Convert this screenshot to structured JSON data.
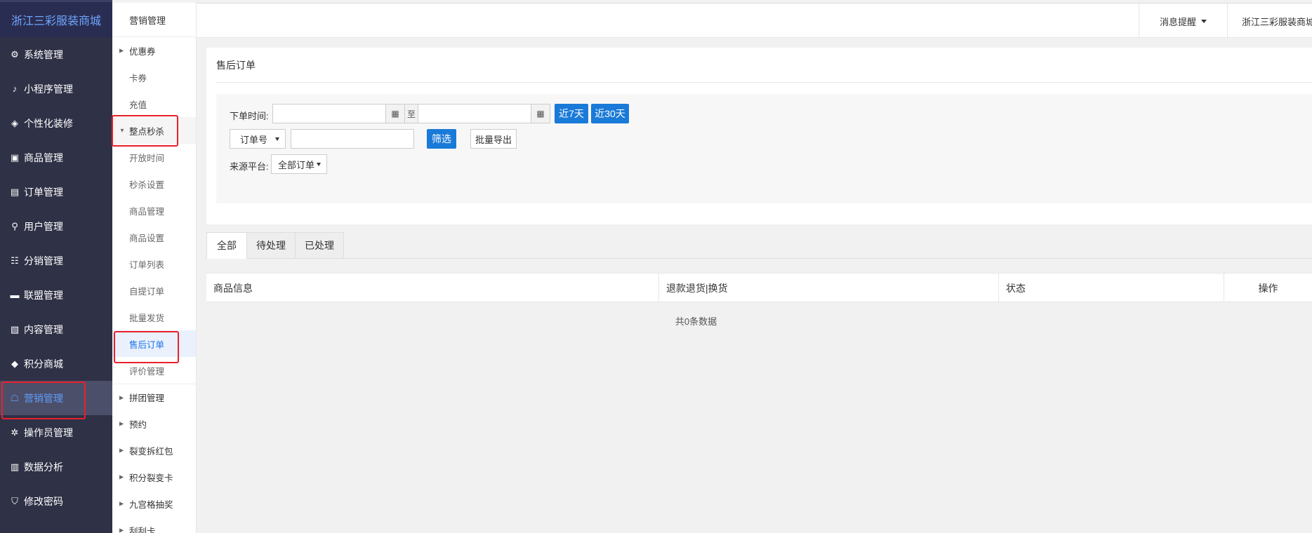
{
  "brand": "浙江三彩服装商城",
  "sidebar": {
    "items": [
      {
        "label": "系统管理",
        "icon": "gear-icon"
      },
      {
        "label": "小程序管理",
        "icon": "miniapp-icon"
      },
      {
        "label": "个性化装修",
        "icon": "palette-icon"
      },
      {
        "label": "商品管理",
        "icon": "bag-icon"
      },
      {
        "label": "订单管理",
        "icon": "clipboard-icon"
      },
      {
        "label": "用户管理",
        "icon": "user-icon"
      },
      {
        "label": "分销管理",
        "icon": "sitemap-icon"
      },
      {
        "label": "联盟管理",
        "icon": "store-icon"
      },
      {
        "label": "内容管理",
        "icon": "content-icon"
      },
      {
        "label": "积分商城",
        "icon": "cube-icon"
      },
      {
        "label": "营销管理",
        "icon": "marketing-icon"
      },
      {
        "label": "操作员管理",
        "icon": "cog-icon"
      },
      {
        "label": "数据分析",
        "icon": "chart-icon"
      },
      {
        "label": "修改密码",
        "icon": "shield-icon"
      }
    ],
    "active_index": 10
  },
  "submenu": {
    "title": "营销管理",
    "items": [
      {
        "label": "优惠券",
        "type": "parent"
      },
      {
        "label": "卡券",
        "type": "plain"
      },
      {
        "label": "充值",
        "type": "plain"
      },
      {
        "label": "整点秒杀",
        "type": "expanded"
      },
      {
        "label": "开放时间",
        "type": "child"
      },
      {
        "label": "秒杀设置",
        "type": "child"
      },
      {
        "label": "商品管理",
        "type": "child"
      },
      {
        "label": "商品设置",
        "type": "child"
      },
      {
        "label": "订单列表",
        "type": "child"
      },
      {
        "label": "自提订单",
        "type": "child"
      },
      {
        "label": "批量发货",
        "type": "child"
      },
      {
        "label": "售后订单",
        "type": "current"
      },
      {
        "label": "评价管理",
        "type": "child"
      },
      {
        "label": "拼团管理",
        "type": "parent"
      },
      {
        "label": "预约",
        "type": "parent"
      },
      {
        "label": "裂变拆红包",
        "type": "parent"
      },
      {
        "label": "积分裂变卡",
        "type": "parent"
      },
      {
        "label": "九宫格抽奖",
        "type": "parent"
      },
      {
        "label": "刮刮卡",
        "type": "parent"
      }
    ]
  },
  "topbar": {
    "messages": "消息提醒",
    "user": "浙江三彩服装商城"
  },
  "page": {
    "title": "售后订单"
  },
  "filter": {
    "order_time_label": "下单时间:",
    "to_label": "至",
    "last7": "近7天",
    "last30": "近30天",
    "order_field_select": "订单号",
    "search_value": "",
    "filter_button": "筛选",
    "export_button": "批量导出",
    "source_label": "来源平台:",
    "source_select": "全部订单"
  },
  "tabs": [
    "全部",
    "待处理",
    "已处理"
  ],
  "table": {
    "columns": [
      "商品信息",
      "退款退货|换货",
      "状态",
      "操作"
    ],
    "empty_text": "共0条数据"
  },
  "colors": {
    "sidebar_bg": "#2f3146",
    "accent": "#1a7ad8",
    "highlight_border": "#e8202a"
  }
}
